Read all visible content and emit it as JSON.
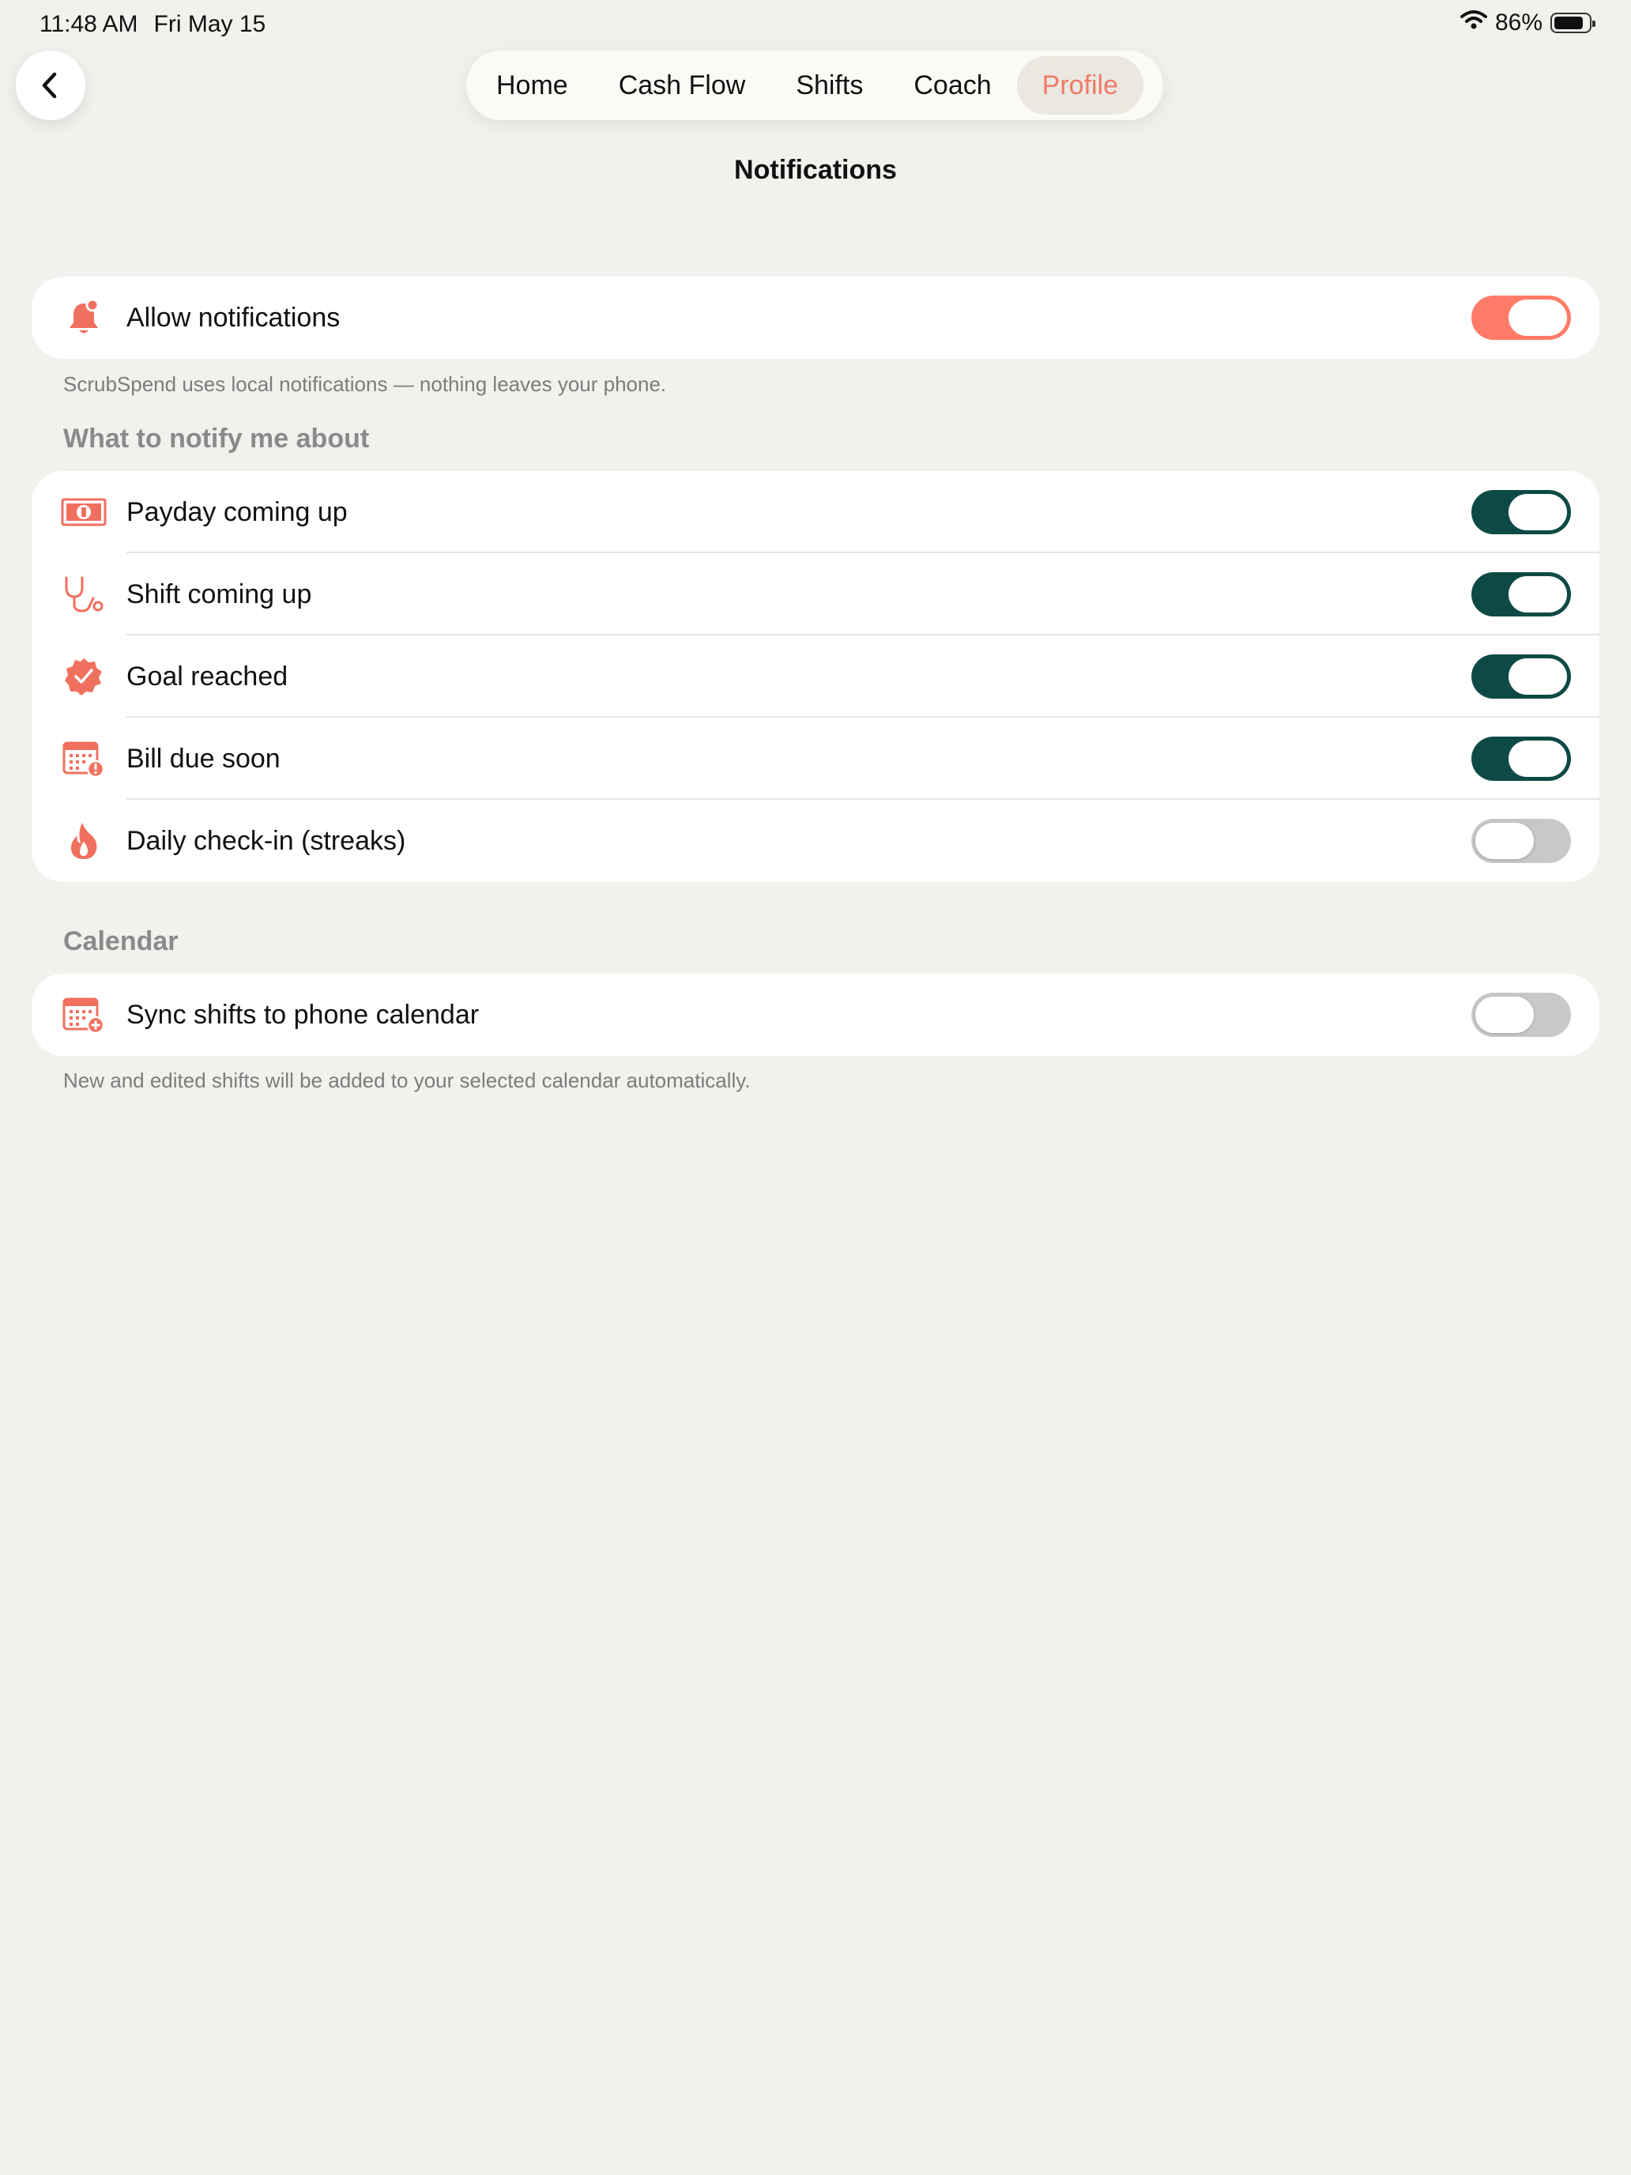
{
  "status_bar": {
    "time": "11:48 AM",
    "date": "Fri May 15",
    "battery": "86%",
    "battery_level": 0.86
  },
  "nav": {
    "tabs": [
      {
        "label": "Home",
        "active": false
      },
      {
        "label": "Cash Flow",
        "active": false
      },
      {
        "label": "Shifts",
        "active": false
      },
      {
        "label": "Coach",
        "active": false
      },
      {
        "label": "Profile",
        "active": true
      }
    ]
  },
  "page": {
    "title": "Notifications"
  },
  "allow": {
    "label": "Allow notifications",
    "enabled": true,
    "footnote": "ScrubSpend uses local notifications — nothing leaves your phone."
  },
  "notify": {
    "header": "What to notify me about",
    "items": [
      {
        "label": "Payday coming up",
        "icon": "banknote-icon",
        "enabled": true
      },
      {
        "label": "Shift coming up",
        "icon": "stethoscope-icon",
        "enabled": true
      },
      {
        "label": "Goal reached",
        "icon": "checkmark-seal-icon",
        "enabled": true
      },
      {
        "label": "Bill due soon",
        "icon": "calendar-alert-icon",
        "enabled": true
      },
      {
        "label": "Daily check-in (streaks)",
        "icon": "flame-icon",
        "enabled": false
      }
    ]
  },
  "calendar": {
    "header": "Calendar",
    "sync_label": "Sync shifts to phone calendar",
    "sync_enabled": false,
    "footnote": "New and edited shifts will be added to your selected calendar automatically."
  },
  "colors": {
    "accent": "#ff7b68",
    "toggle_on": "#0e4a45",
    "toggle_off": "#c8c8c8",
    "background": "#f2f1ed"
  }
}
